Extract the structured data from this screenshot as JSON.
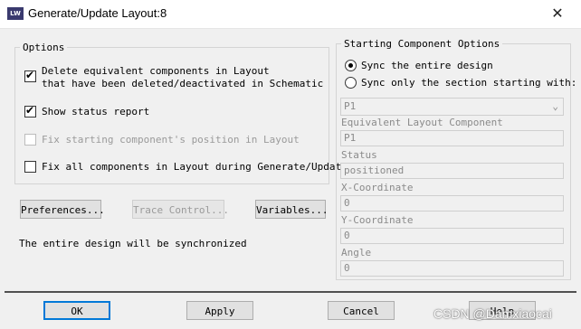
{
  "window": {
    "title": "Generate/Update Layout:8",
    "app_icon": "pcb-layout-icon",
    "close_glyph": "✕"
  },
  "options": {
    "legend": "Options",
    "delete_equivalent": {
      "line1": "Delete equivalent components in Layout",
      "line2": "that have been deleted/deactivated in Schematic",
      "checked": true
    },
    "show_status_report": {
      "label": "Show status report",
      "checked": true
    },
    "fix_starting": {
      "label": "Fix starting component's position in Layout",
      "checked": false,
      "enabled": false
    },
    "fix_all": {
      "label": "Fix all components in Layout during Generate/Update",
      "checked": false
    }
  },
  "buttons": {
    "preferences": "Preferences...",
    "trace_control": "Trace Control...",
    "variables": "Variables...",
    "ok": "OK",
    "apply": "Apply",
    "cancel": "Cancel",
    "help": "Help"
  },
  "status_message": "The entire design will be synchronized",
  "starting": {
    "legend": "Starting Component Options",
    "sync_entire": {
      "label": "Sync the entire design",
      "selected": true
    },
    "sync_section": {
      "label": "Sync only the section starting with:",
      "selected": false
    },
    "component_select": {
      "value": "P1"
    },
    "equivalent_layout_component": {
      "label": "Equivalent Layout Component",
      "value": "P1"
    },
    "status": {
      "label": "Status",
      "value": "positioned"
    },
    "x_coordinate": {
      "label": "X-Coordinate",
      "value": "0"
    },
    "y_coordinate": {
      "label": "Y-Coordinate",
      "value": "0"
    },
    "angle": {
      "label": "Angle",
      "value": "0"
    }
  },
  "watermark": "CSDN @Damxiaocai",
  "colors": {
    "default_button_border": "#0078d7",
    "disabled_text": "#9a9a9a"
  }
}
